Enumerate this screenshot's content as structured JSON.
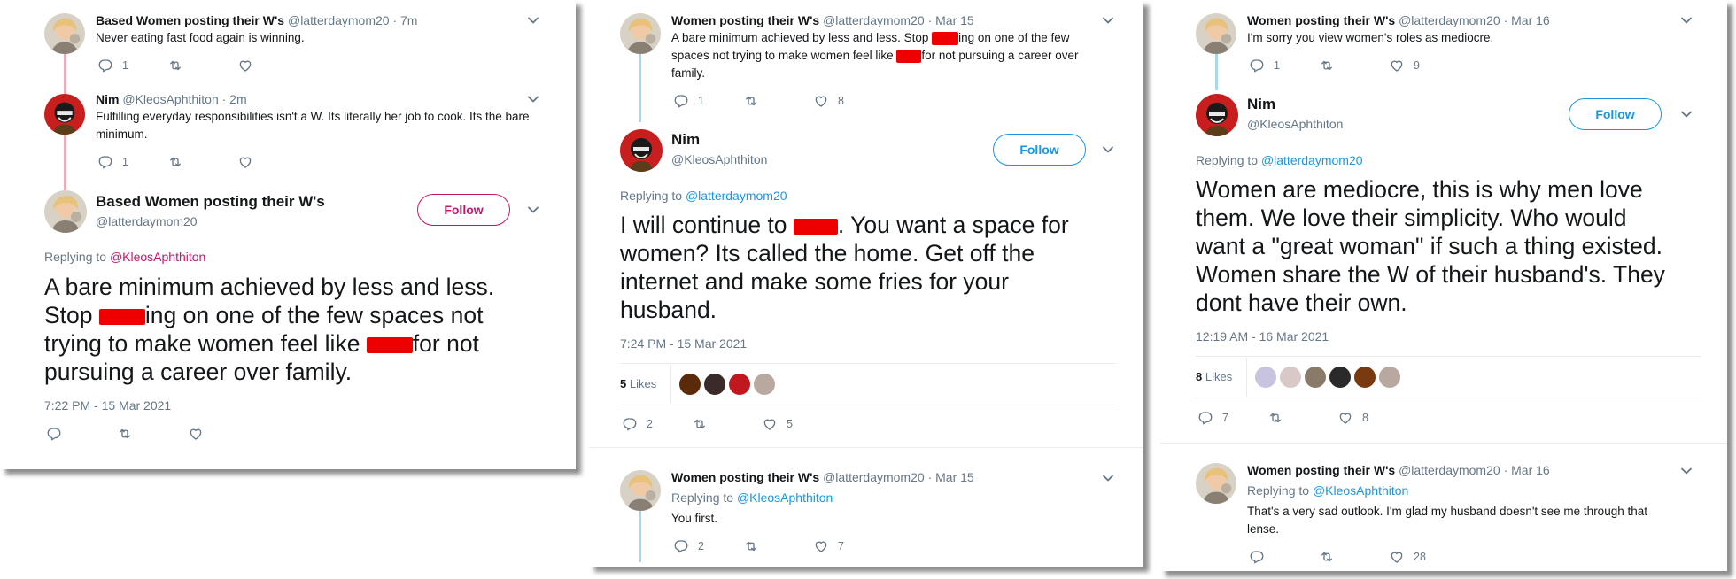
{
  "colors": {
    "pink_line": "#f4a8b8",
    "blue_line": "#a8d8ee",
    "link": "#1b95e0",
    "follow_pink": "#c5166a",
    "follow_blue": "#1b95e0",
    "redaction": "#ee0000"
  },
  "panel1": {
    "t1": {
      "name": "Based Women posting their W's",
      "handle": "@latterdaymom20",
      "time": "· 7m",
      "text": "Never eating fast food again is winning.",
      "replies": "1",
      "retweets": "",
      "likes": ""
    },
    "t2": {
      "name": "Nim",
      "handle": "@KleosAphthiton",
      "time": "· 2m",
      "text": "Fulfilling everyday responsibilities isn't a W. Its literally her job to cook. Its the bare minimum.",
      "replies": "1",
      "retweets": "",
      "likes": ""
    },
    "main": {
      "name": "Based Women posting their W's",
      "handle": "@latterdaymom20",
      "follow": "Follow",
      "replying_prefix": "Replying to ",
      "replying_to": "@KleosAphthiton",
      "line1": "A bare minimum achieved by less and less.",
      "line2a": "Stop ",
      "line2b": "ing on one of the few spaces not",
      "line3a": "trying to make women feel like ",
      "line3b": "for not",
      "line4": "pursuing a career over family.",
      "timestamp": "7:22 PM - 15 Mar 2021"
    }
  },
  "panel2": {
    "t1": {
      "name": "Women posting their W's",
      "handle": "@latterdaymom20",
      "time": "· Mar 15",
      "line1a": "A bare minimum achieved by less and less. Stop ",
      "line1b": "ing on one of the few",
      "line2a": "spaces not trying to make women feel like ",
      "line2b": "for not pursuing a career over",
      "line3": "family.",
      "replies": "1",
      "likes": "8"
    },
    "main": {
      "name": "Nim",
      "handle": "@KleosAphthiton",
      "follow": "Follow",
      "replying_prefix": "Replying to ",
      "replying_to": "@latterdaymom20",
      "line1a": "I will continue to ",
      "line1b": ". You want a space for",
      "line2": "women? Its called the home. Get off the",
      "line3": "internet and make some fries for your",
      "line4": "husband.",
      "timestamp": "7:24 PM - 15 Mar 2021",
      "likes_count": "5",
      "likes_label": " Likes",
      "replies": "2",
      "favs": "5"
    },
    "t3": {
      "name": "Women posting their W's",
      "handle": "@latterdaymom20",
      "time": "· Mar 15",
      "replying_prefix": "Replying to ",
      "replying_to": "@KleosAphthiton",
      "text": "You first.",
      "replies": "2",
      "likes": "7"
    }
  },
  "panel3": {
    "t1": {
      "name": "Women posting their W's",
      "handle": "@latterdaymom20",
      "time": "· Mar 16",
      "text": "I'm sorry you view women's roles as mediocre.",
      "replies": "1",
      "likes": "9"
    },
    "main": {
      "name": "Nim",
      "handle": "@KleosAphthiton",
      "follow": "Follow",
      "replying_prefix": "Replying to ",
      "replying_to": "@latterdaymom20",
      "lines": [
        "Women are mediocre, this is why men love",
        "them. We love their simplicity. Who would",
        "want a \"great woman\" if such a thing existed.",
        "Women share the W of their husband's. They",
        "dont have their own."
      ],
      "timestamp": "12:19 AM - 16 Mar 2021",
      "likes_count": "8",
      "likes_label": " Likes",
      "replies": "7",
      "favs": "8"
    },
    "t3": {
      "name": "Women posting their W's",
      "handle": "@latterdaymom20",
      "time": "· Mar 16",
      "replying_prefix": "Replying to ",
      "replying_to": "@KleosAphthiton",
      "line1": "That's a very sad outlook. I'm glad my husband doesn't see me through that",
      "line2": "lense.",
      "likes": "28"
    }
  }
}
